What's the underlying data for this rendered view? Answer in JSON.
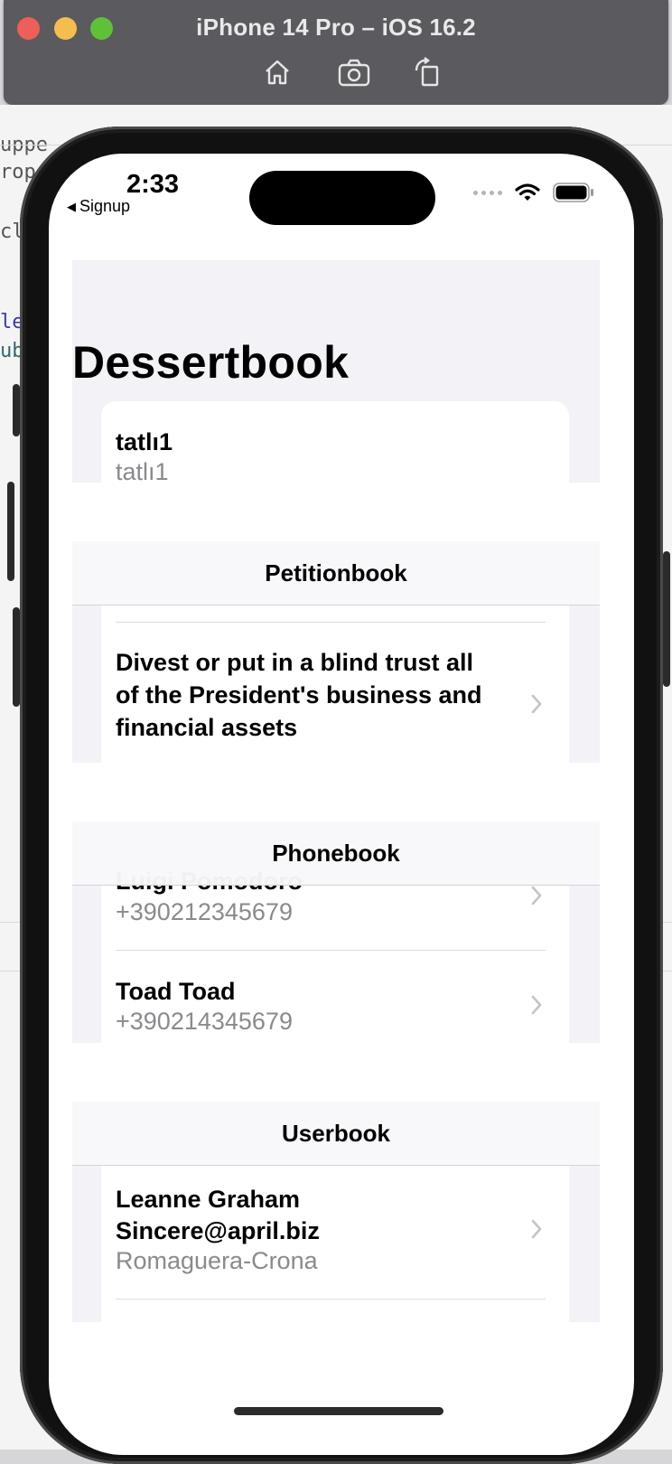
{
  "simulator": {
    "title": "iPhone 14 Pro – iOS 16.2",
    "buttons": [
      "home-icon",
      "screenshot-icon",
      "rotate-icon"
    ]
  },
  "background_code": [
    "uppe",
    "rop",
    "cl",
    "le",
    "ub"
  ],
  "status_bar": {
    "time": "2:33",
    "back_label": "Signup"
  },
  "app": {
    "title": "Dessertbook",
    "dessertbook": {
      "items": [
        {
          "primary": "tatlı1",
          "secondary": "tatlı1"
        }
      ]
    },
    "petitionbook": {
      "header": "Petitionbook",
      "items": [
        {
          "primary": "Divest or put in a blind trust all",
          "primary2": "of the President's business and",
          "primary3": "financial assets"
        }
      ]
    },
    "phonebook": {
      "header": "Phonebook",
      "items": [
        {
          "primary": "Luigi Pomodoro",
          "secondary": "+390212345679"
        },
        {
          "primary": "Toad Toad",
          "secondary": "+390214345679"
        }
      ]
    },
    "userbook": {
      "header": "Userbook",
      "items": [
        {
          "primary": "Leanne Graham",
          "secondary_bold": "Sincere@april.biz",
          "secondary": "Romaguera-Crona"
        }
      ]
    }
  },
  "colors": {
    "grouped_background": "#f2f2f7",
    "secondary_text": "#8a8a8e",
    "chevron": "#c4c4c7"
  }
}
